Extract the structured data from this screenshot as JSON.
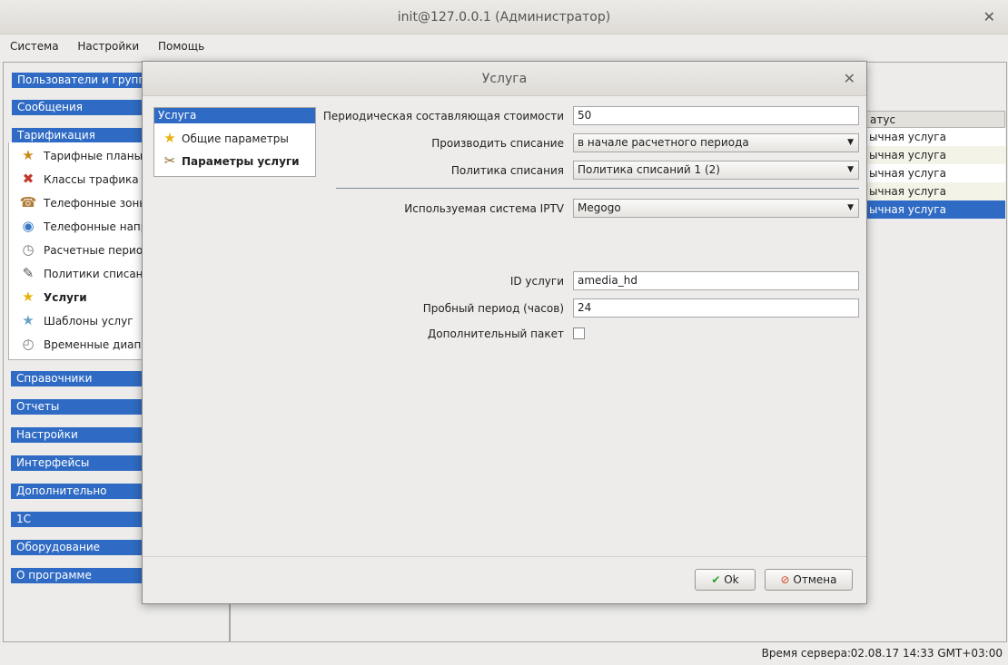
{
  "window": {
    "title": "init@127.0.0.1 (Администратор)"
  },
  "menubar": [
    "Система",
    "Настройки",
    "Помощь"
  ],
  "left_panel": {
    "categories_top": [
      "Пользователи и группы",
      "Сообщения",
      "Тарификация"
    ],
    "tarification_items": [
      {
        "label": "Тарифные планы",
        "icon": "tariff-plans-icon"
      },
      {
        "label": "Классы трафика",
        "icon": "traffic-classes-icon"
      },
      {
        "label": "Телефонные зоны",
        "icon": "phone-zones-icon"
      },
      {
        "label": "Телефонные напр",
        "icon": "phone-directions-icon"
      },
      {
        "label": "Расчетные период",
        "icon": "billing-periods-icon"
      },
      {
        "label": "Политики списани",
        "icon": "charge-policies-icon"
      },
      {
        "label": "Услуги",
        "icon": "star-icon"
      },
      {
        "label": "Шаблоны услуг",
        "icon": "service-templates-icon"
      },
      {
        "label": "Временные диапаз",
        "icon": "time-ranges-icon"
      }
    ],
    "categories_bottom": [
      "Справочники",
      "Отчеты",
      "Настройки",
      "Интерфейсы",
      "Дополнительно",
      "1С",
      "Оборудование",
      "О программе"
    ]
  },
  "table": {
    "header": "атус",
    "rows": [
      "ычная услуга",
      "ычная услуга",
      "ычная услуга",
      "ычная услуга",
      "ычная услуга"
    ],
    "selected_index": 4
  },
  "statusbar": {
    "label": "Время сервера:",
    "value": "02.08.17 14:33 GMT+03:00"
  },
  "dialog": {
    "title": "Услуга",
    "nav": {
      "header": "Услуга",
      "items": [
        {
          "label": "Общие параметры",
          "icon": "star-icon"
        },
        {
          "label": "Параметры услуги",
          "icon": "tools-icon"
        }
      ]
    },
    "fields": {
      "periodic_cost": {
        "label": "Периодическая составляющая стоимости",
        "value": "50"
      },
      "charge_mode": {
        "label": "Производить списание",
        "value": "в начале расчетного периода"
      },
      "charge_policy": {
        "label": "Политика списания",
        "value": "Политика списаний 1 (2)"
      },
      "iptv_system": {
        "label": "Используемая система IPTV",
        "value": "Megogo"
      },
      "service_id": {
        "label": "ID услуги",
        "value": "amedia_hd"
      },
      "trial_period": {
        "label": "Пробный период (часов)",
        "value": "24"
      },
      "extra_package": {
        "label": "Дополнительный пакет",
        "checked": false
      }
    },
    "buttons": {
      "ok": "Ok",
      "cancel": "Отмена"
    }
  },
  "colors": {
    "accent": "#2f6bc4",
    "ok_green": "#2e9e2e",
    "cancel_red": "#d9452b"
  }
}
